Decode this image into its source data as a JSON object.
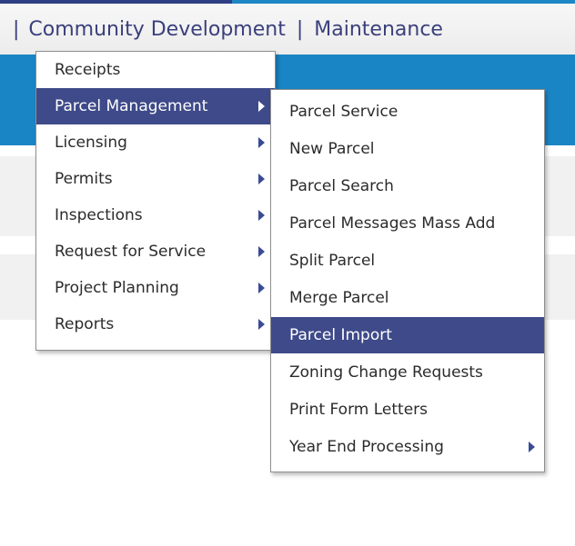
{
  "navbar": {
    "separator": "|",
    "items": [
      "Community Development",
      "Maintenance"
    ]
  },
  "main_menu": {
    "items": [
      {
        "label": "Receipts",
        "has_submenu": false,
        "active": false
      },
      {
        "label": "Parcel Management",
        "has_submenu": true,
        "active": true
      },
      {
        "label": "Licensing",
        "has_submenu": true,
        "active": false
      },
      {
        "label": "Permits",
        "has_submenu": true,
        "active": false
      },
      {
        "label": "Inspections",
        "has_submenu": true,
        "active": false
      },
      {
        "label": "Request for Service",
        "has_submenu": true,
        "active": false
      },
      {
        "label": "Project Planning",
        "has_submenu": true,
        "active": false
      },
      {
        "label": "Reports",
        "has_submenu": true,
        "active": false
      }
    ]
  },
  "submenu": {
    "items": [
      {
        "label": "Parcel Service",
        "has_submenu": false,
        "active": false
      },
      {
        "label": "New Parcel",
        "has_submenu": false,
        "active": false
      },
      {
        "label": "Parcel Search",
        "has_submenu": false,
        "active": false
      },
      {
        "label": "Parcel Messages Mass Add",
        "has_submenu": false,
        "active": false
      },
      {
        "label": "Split Parcel",
        "has_submenu": false,
        "active": false
      },
      {
        "label": "Merge Parcel",
        "has_submenu": false,
        "active": false
      },
      {
        "label": "Parcel Import",
        "has_submenu": false,
        "active": true
      },
      {
        "label": "Zoning Change Requests",
        "has_submenu": false,
        "active": false
      },
      {
        "label": "Print Form Letters",
        "has_submenu": false,
        "active": false
      },
      {
        "label": "Year End Processing",
        "has_submenu": true,
        "active": false
      }
    ]
  },
  "colors": {
    "accent_dark": "#3e4a89",
    "banner_blue": "#1a85c4",
    "arrow": "#3a4b95"
  }
}
